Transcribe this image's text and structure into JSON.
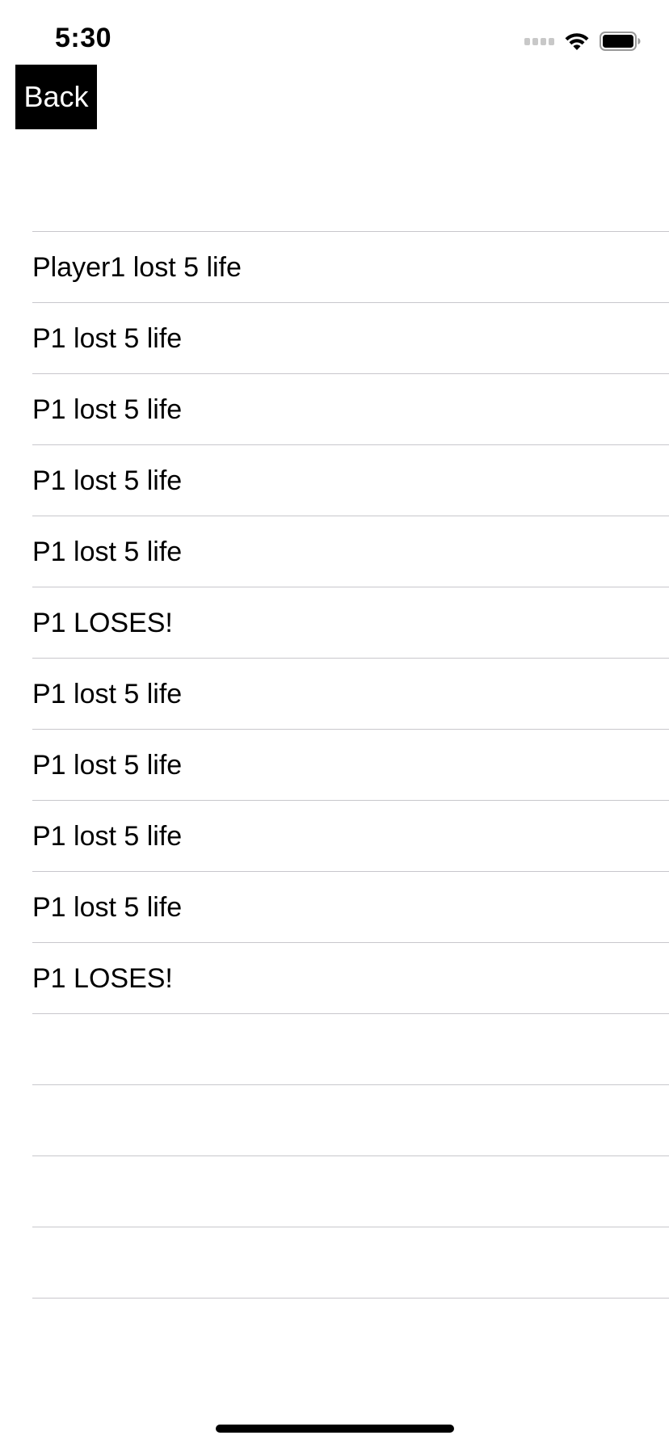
{
  "status_bar": {
    "time": "5:30",
    "icons": [
      "cellular-signal-icon",
      "wifi-icon",
      "battery-icon"
    ]
  },
  "nav": {
    "back_label": "Back"
  },
  "log": {
    "rows": [
      "Player1 lost 5 life",
      "P1 lost 5 life",
      "P1 lost 5 life",
      "P1 lost 5 life",
      "P1 lost 5 life",
      "P1 LOSES!",
      "P1 lost 5 life",
      "P1 lost 5 life",
      "P1 lost 5 life",
      "P1 lost 5 life",
      "P1 LOSES!",
      "",
      "",
      "",
      ""
    ]
  },
  "colors": {
    "background": "#ffffff",
    "text": "#000000",
    "button_bg": "#000000",
    "button_text": "#ffffff",
    "separator": "#c8c7cc"
  }
}
